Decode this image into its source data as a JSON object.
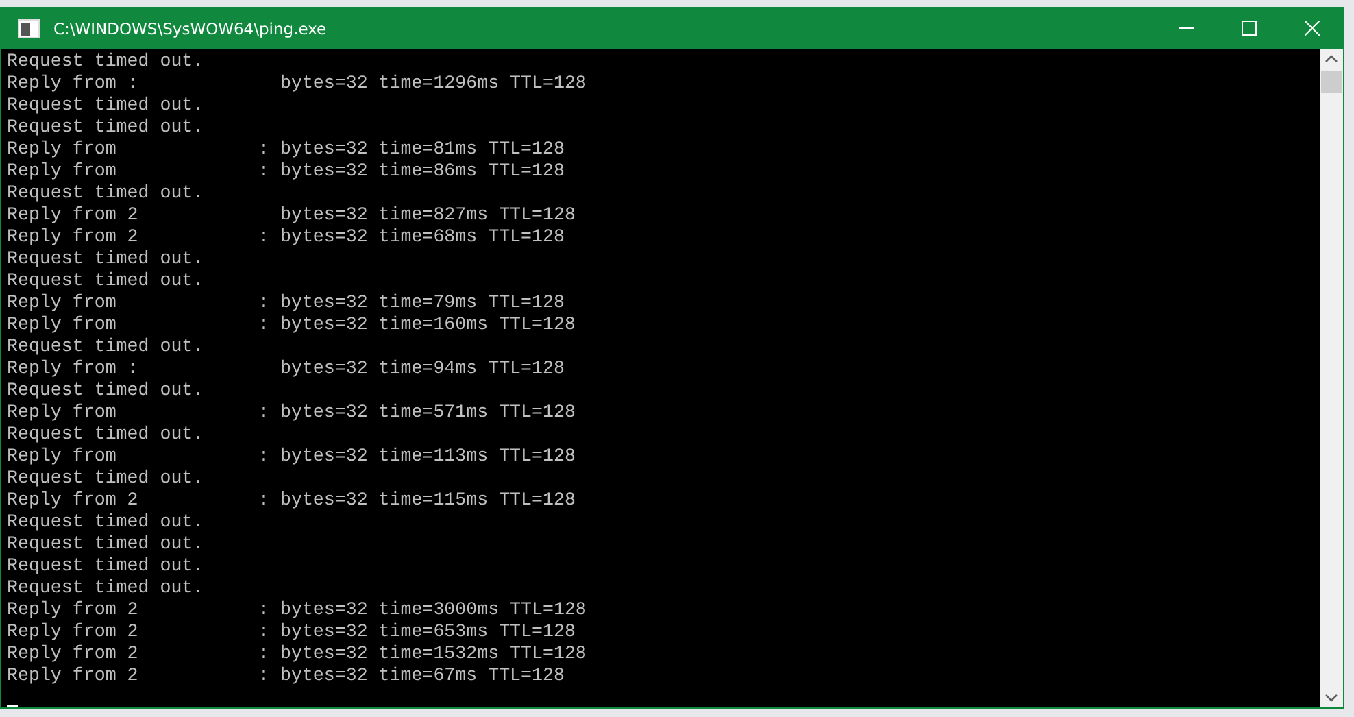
{
  "window": {
    "title": "C:\\WINDOWS\\SysWOW64\\ping.exe"
  },
  "console": {
    "lines": [
      "Request timed out.",
      "Reply from :             bytes=32 time=1296ms TTL=128",
      "Request timed out.",
      "Request timed out.",
      "Reply from             : bytes=32 time=81ms TTL=128",
      "Reply from             : bytes=32 time=86ms TTL=128",
      "Request timed out.",
      "Reply from 2             bytes=32 time=827ms TTL=128",
      "Reply from 2           : bytes=32 time=68ms TTL=128",
      "Request timed out.",
      "Request timed out.",
      "Reply from             : bytes=32 time=79ms TTL=128",
      "Reply from             : bytes=32 time=160ms TTL=128",
      "Request timed out.",
      "Reply from :             bytes=32 time=94ms TTL=128",
      "Request timed out.",
      "Reply from             : bytes=32 time=571ms TTL=128",
      "Request timed out.",
      "Reply from             : bytes=32 time=113ms TTL=128",
      "Request timed out.",
      "Reply from 2           : bytes=32 time=115ms TTL=128",
      "Request timed out.",
      "Request timed out.",
      "Request timed out.",
      "Request timed out.",
      "Reply from 2           : bytes=32 time=3000ms TTL=128",
      "Reply from 2           : bytes=32 time=653ms TTL=128",
      "Reply from 2           : bytes=32 time=1532ms TTL=128",
      "Reply from 2           : bytes=32 time=67ms TTL=128"
    ]
  }
}
